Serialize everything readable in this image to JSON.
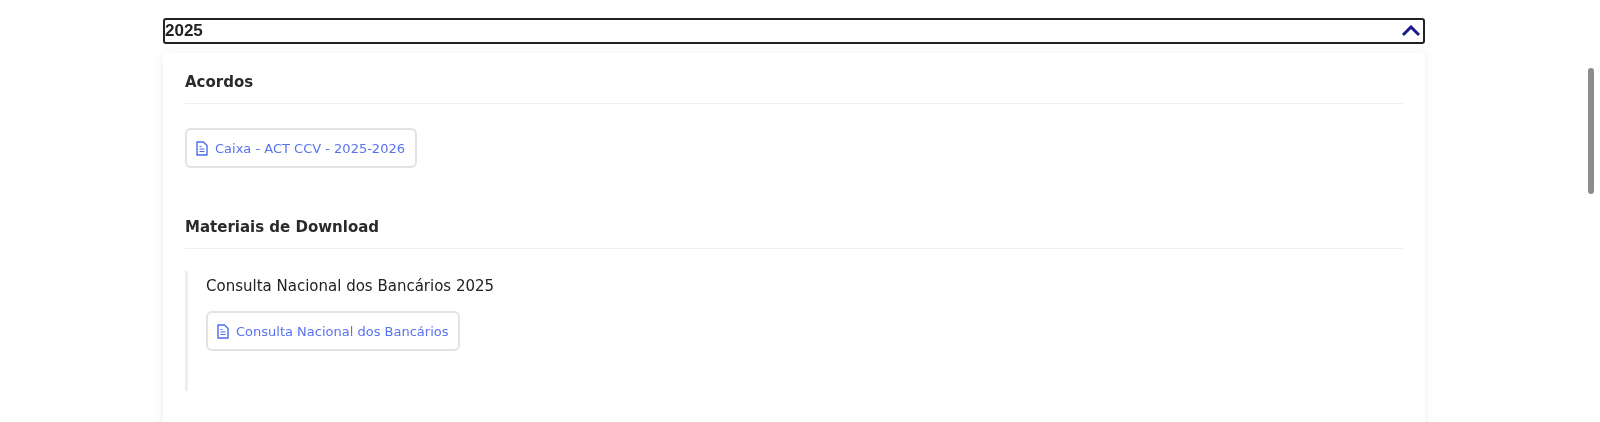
{
  "accordion": {
    "title": "2025",
    "expanded": true
  },
  "sections": [
    {
      "kind": "files",
      "title": "Acordos",
      "files": [
        "Caixa - ACT CCV - 2025-2026"
      ]
    },
    {
      "kind": "groups",
      "title": "Materiais de Download",
      "groups": [
        {
          "title": "Consulta Nacional dos Bancários 2025",
          "files": [
            "Consulta Nacional dos Bancários"
          ]
        }
      ]
    }
  ]
}
